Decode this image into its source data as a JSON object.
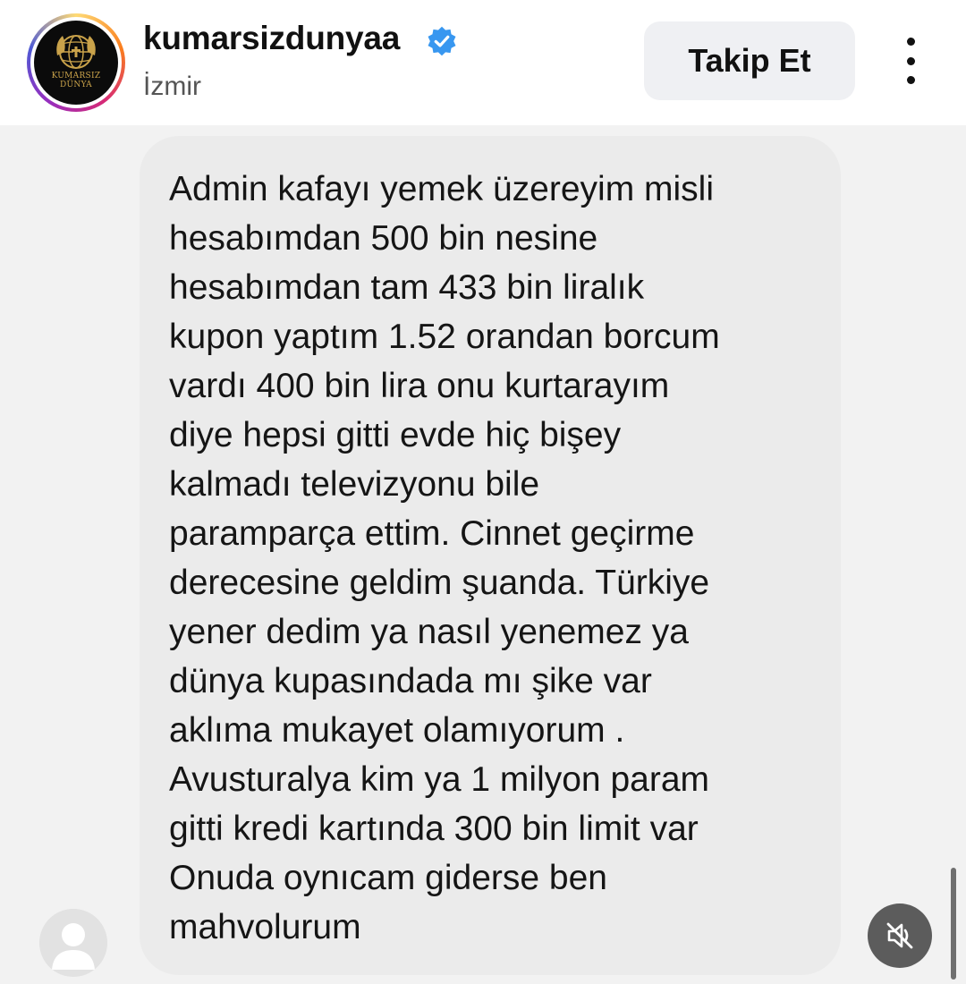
{
  "profile": {
    "username": "kumarsizdunyaa",
    "location": "İzmir",
    "verified": true,
    "logo_text_line1": "KUMARSIZ",
    "logo_text_line2": "DÜNYA"
  },
  "actions": {
    "follow_label": "Takip Et",
    "more_icon": "more-vertical-icon",
    "mute_icon": "speaker-muted-icon"
  },
  "message": {
    "lines": [
      "Admin kafayı yemek üzereyim misli",
      "hesabımdan 500 bin nesine",
      "hesabımdan tam 433 bin liralık",
      "kupon yaptım 1.52 orandan borcum",
      "vardı 400 bin lira onu kurtarayım",
      "diye hepsi gitti evde hiç bişey",
      "kalmadı televizyonu bile",
      "paramparça ettim. Cinnet geçirme",
      "derecesine geldim şuanda. Türkiye",
      "yener dedim ya nasıl yenemez ya",
      "dünya kupasındada mı şike var",
      "aklıma mukayet olamıyorum .",
      "Avusturalya kim ya 1 milyon param",
      "gitti kredi kartında 300 bin limit var",
      "Onuda oynıcam giderse ben",
      "mahvolurum"
    ]
  },
  "colors": {
    "verified_blue": "#3897f0",
    "bubble_bg": "#ebebeb",
    "page_bg": "#f2f2f2",
    "logo_gold": "#c9a24a"
  }
}
